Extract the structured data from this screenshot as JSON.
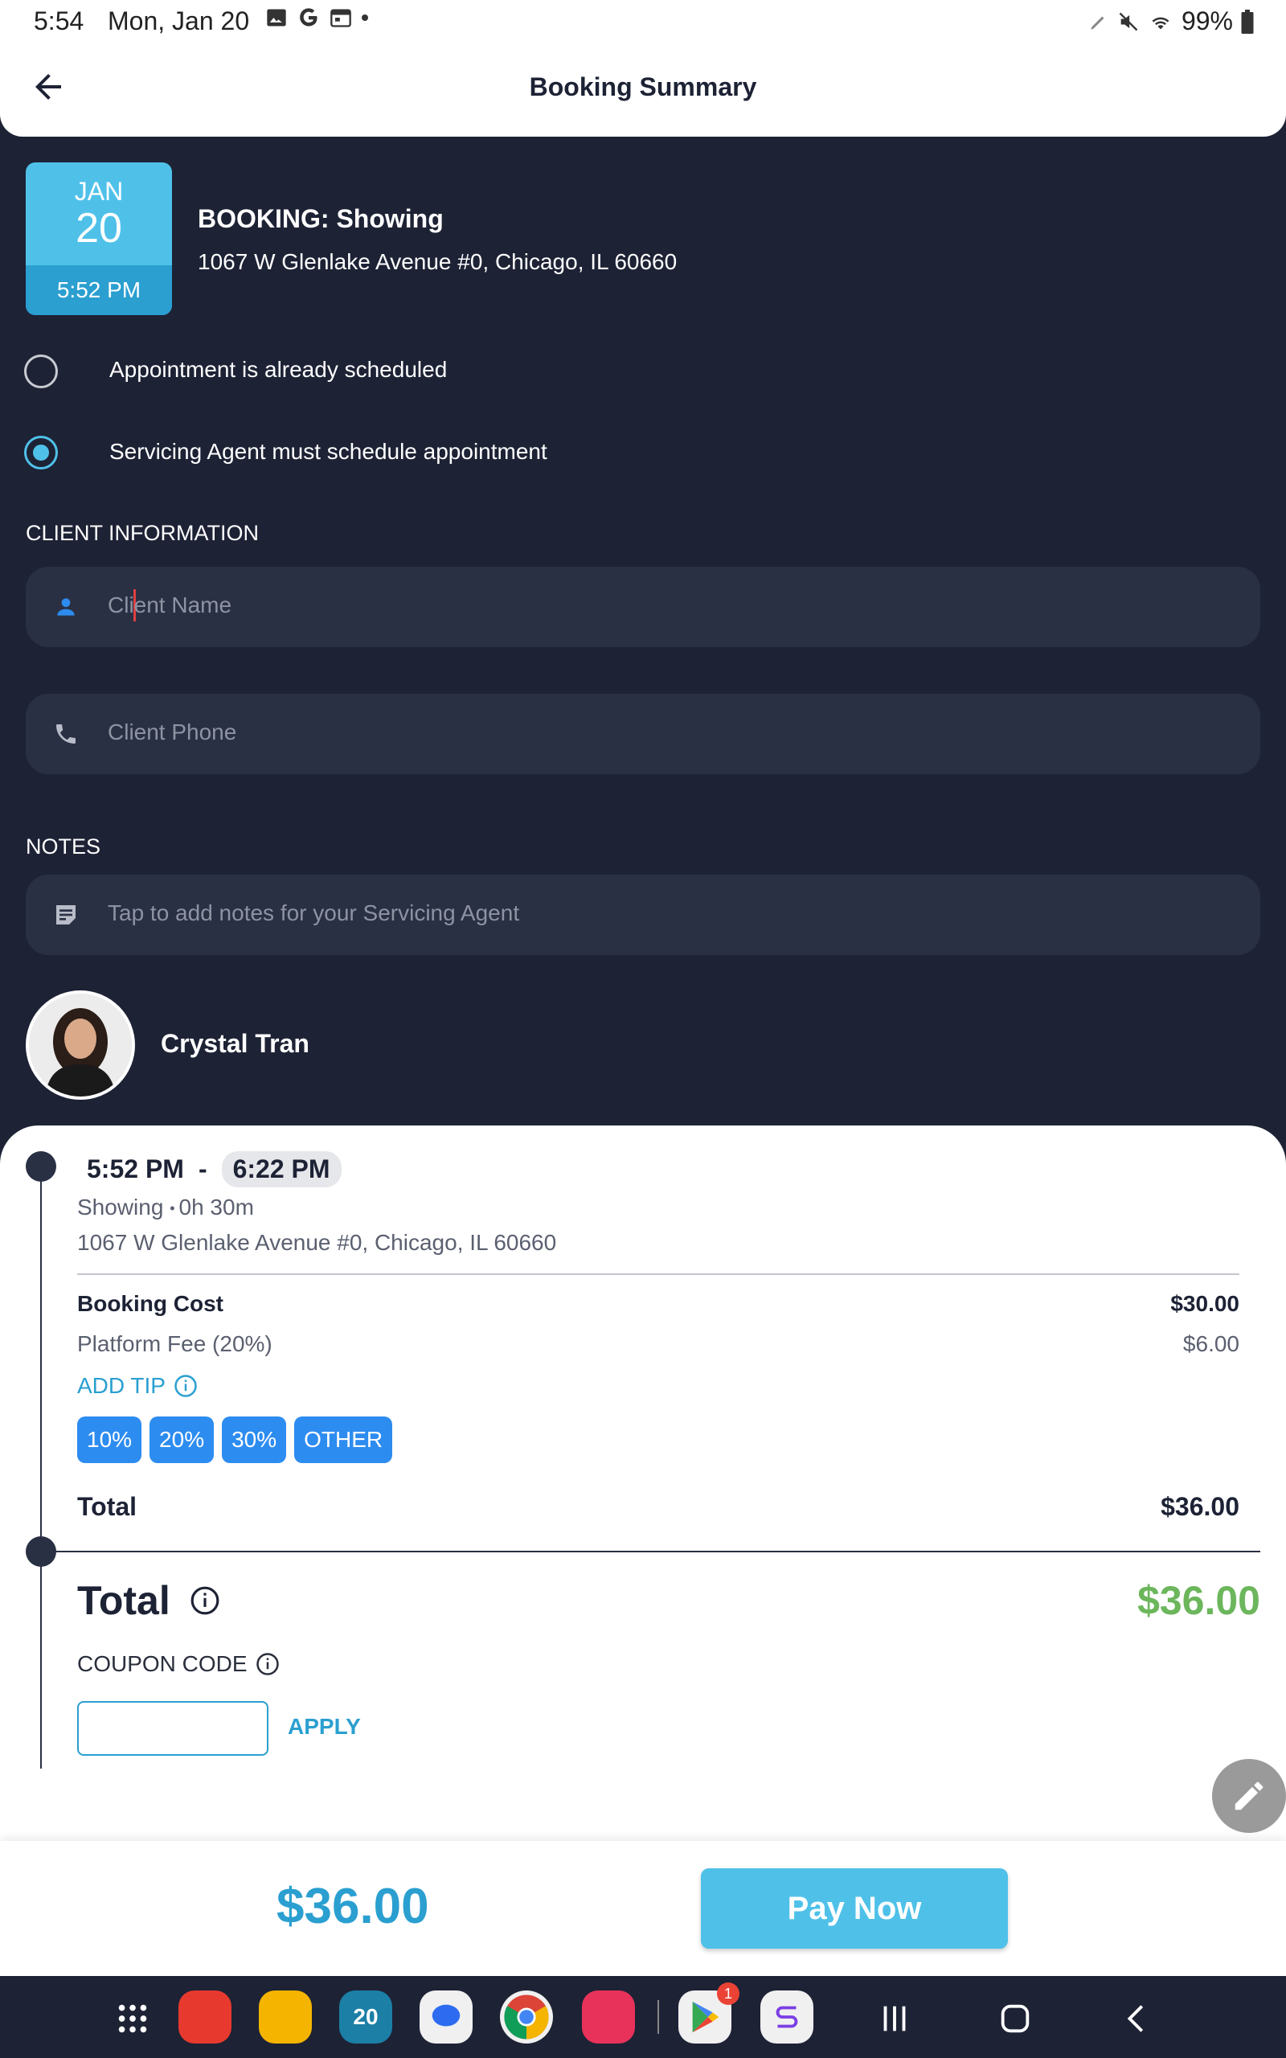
{
  "status_bar": {
    "time": "5:54",
    "date": "Mon, Jan 20",
    "battery": "99%"
  },
  "header": {
    "title": "Booking Summary"
  },
  "booking": {
    "month": "JAN",
    "day": "20",
    "time": "5:52 PM",
    "title": "BOOKING: Showing",
    "address": "1067 W Glenlake Avenue #0, Chicago, IL 60660"
  },
  "scheduling": {
    "option1": "Appointment is already scheduled",
    "option2": "Servicing Agent must schedule appointment",
    "selected": "option2"
  },
  "client": {
    "section_label": "CLIENT INFORMATION",
    "name_placeholder": "Client Name",
    "phone_placeholder": "Client Phone"
  },
  "notes": {
    "section_label": "NOTES",
    "placeholder": "Tap to add notes for your Servicing Agent"
  },
  "agent": {
    "name": "Crystal Tran"
  },
  "summary": {
    "start_time": "5:52 PM",
    "separator": "-",
    "end_time": "6:22 PM",
    "service": "Showing",
    "duration": "0h 30m",
    "address": "1067 W Glenlake Avenue #0, Chicago, IL 60660",
    "booking_cost_label": "Booking Cost",
    "booking_cost": "$30.00",
    "platform_fee_label": "Platform Fee (20%)",
    "platform_fee": "$6.00",
    "add_tip_label": "ADD TIP",
    "tips": [
      "10%",
      "20%",
      "30%",
      "OTHER"
    ],
    "total_label": "Total",
    "total": "$36.00",
    "grand_total_label": "Total",
    "grand_total": "$36.00",
    "coupon_label": "COUPON CODE",
    "apply_label": "APPLY"
  },
  "pay": {
    "amount": "$36.00",
    "button_label": "Pay Now"
  },
  "nav": {
    "calendar_badge": "20",
    "play_badge": "1"
  },
  "colors": {
    "background": "#1d2235",
    "accent": "#4fc1e9",
    "accent_dark": "#2a9fd0",
    "tip_button": "#2d8cf0",
    "total_green": "#6cb65c"
  }
}
